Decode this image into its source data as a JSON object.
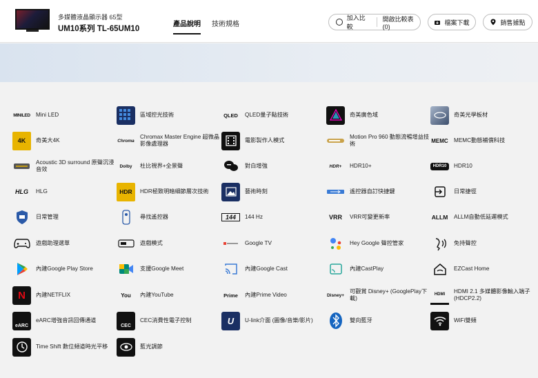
{
  "header": {
    "product_sub": "多媒體液晶顯示器  65型",
    "product_model": "UM10系列  TL-65UM10",
    "tabs": [
      "產品說明",
      "技術規格"
    ],
    "compare_add": "加入比較",
    "compare_open": "開啟比較表(0)",
    "download": "檔案下載",
    "locations": "銷售據點"
  },
  "features": [
    {
      "label": "Mini LED",
      "icon": "mini-led-logo",
      "icon_text": "MINILED"
    },
    {
      "label": "區域控光技術",
      "icon": "local-dimming-icon"
    },
    {
      "label": "QLED量子點技術",
      "icon": "qled-logo",
      "icon_text": "QLED"
    },
    {
      "label": "奇美廣色域",
      "icon": "wide-color-gamut-icon"
    },
    {
      "label": "奇美光學板材",
      "icon": "optical-panel-icon"
    },
    {
      "label": "奇美大4K",
      "icon": "4k-hdr-logo",
      "icon_text": "4K"
    },
    {
      "label": "Chromax Master Engine 超微晶影像處理器",
      "icon": "chromax-logo",
      "icon_text": "Chroma"
    },
    {
      "label": "電影製作人模式",
      "icon": "filmmaker-mode-icon"
    },
    {
      "label": "Motion Pro 960 動態流暢增益技術",
      "icon": "motion-pro-icon"
    },
    {
      "label": "MEMC動態補償科技",
      "icon": "memc-logo",
      "icon_text": "MEMC"
    },
    {
      "label": "Acoustic 3D surround 原聲沉浸音效",
      "icon": "acoustic-3d-icon"
    },
    {
      "label": "杜比視界+全景聲",
      "icon": "dolby-logo",
      "icon_text": "Dolby"
    },
    {
      "label": "對白增強",
      "icon": "dialog-enhance-icon"
    },
    {
      "label": "HDR10+",
      "icon": "hdr10plus-logo",
      "icon_text": "HDR+"
    },
    {
      "label": "HDR10",
      "icon": "hdr10-logo",
      "icon_text": "HDR10"
    },
    {
      "label": "HLG",
      "icon": "hlg-logo",
      "icon_text": "HLG"
    },
    {
      "label": "HDR極致明暗細節層次技術",
      "icon": "hdr-detail-logo",
      "icon_text": "HDR"
    },
    {
      "label": "藝術時刻",
      "icon": "art-mode-icon"
    },
    {
      "label": "遙控器自訂快捷鍵",
      "icon": "remote-shortcut-icon"
    },
    {
      "label": "日常捷徑",
      "icon": "daily-shortcut-icon"
    },
    {
      "label": "日常管理",
      "icon": "tv-shield-icon"
    },
    {
      "label": "尋找遙控器",
      "icon": "find-remote-icon"
    },
    {
      "label": "144 Hz",
      "icon": "144hz-logo",
      "icon_text": "144"
    },
    {
      "label": "VRR可變更新率",
      "icon": "vrr-logo",
      "icon_text": "VRR"
    },
    {
      "label": "ALLM自動低延遲模式",
      "icon": "allm-logo",
      "icon_text": "ALLM"
    },
    {
      "label": "遊戲助理選單",
      "icon": "gamepad-icon"
    },
    {
      "label": "遊戲模式",
      "icon": "game-mode-icon"
    },
    {
      "label": "Google TV",
      "icon": "google-tv-logo"
    },
    {
      "label": "Hey Google 聲控管家",
      "icon": "google-assistant-icon"
    },
    {
      "label": "免持聲控",
      "icon": "hands-free-voice-icon"
    },
    {
      "label": "內建Google Play Store",
      "icon": "google-play-icon"
    },
    {
      "label": "支援Google Meet",
      "icon": "google-meet-icon"
    },
    {
      "label": "內建Google Cast",
      "icon": "google-cast-icon"
    },
    {
      "label": "內建CastPlay",
      "icon": "castplay-icon"
    },
    {
      "label": "EZCast Home",
      "icon": "ezcast-home-icon"
    },
    {
      "label": "內建NETFLIX",
      "icon": "netflix-icon",
      "icon_text": "N"
    },
    {
      "label": "內建YouTube",
      "icon": "youtube-logo",
      "icon_text": "You"
    },
    {
      "label": "內建Prime Video",
      "icon": "prime-video-logo",
      "icon_text": "Prime"
    },
    {
      "label": "可觀賞 Disney+ (GooglePlay下載)",
      "icon": "disney-plus-logo",
      "icon_text": "Disney+"
    },
    {
      "label": "HDMI 2.1 多媒體影像輸入端子(HDCP2.2)",
      "icon": "hdmi-icon",
      "icon_text": "HDMI"
    },
    {
      "label": "eARC增強音訊回傳通道",
      "icon": "earc-icon",
      "icon_text": "eARC"
    },
    {
      "label": "CEC消費性電子控制",
      "icon": "cec-icon",
      "icon_text": "CEC"
    },
    {
      "label": "U-link介面 (圖像/音樂/影片)",
      "icon": "ulink-icon",
      "icon_text": "U"
    },
    {
      "label": "雙向藍牙",
      "icon": "bluetooth-icon"
    },
    {
      "label": "WiFi雙頻",
      "icon": "wifi-icon"
    },
    {
      "label": "Time Shift 數位頻道時光平移",
      "icon": "time-shift-icon"
    },
    {
      "label": "藍光調節",
      "icon": "blue-light-icon"
    }
  ]
}
